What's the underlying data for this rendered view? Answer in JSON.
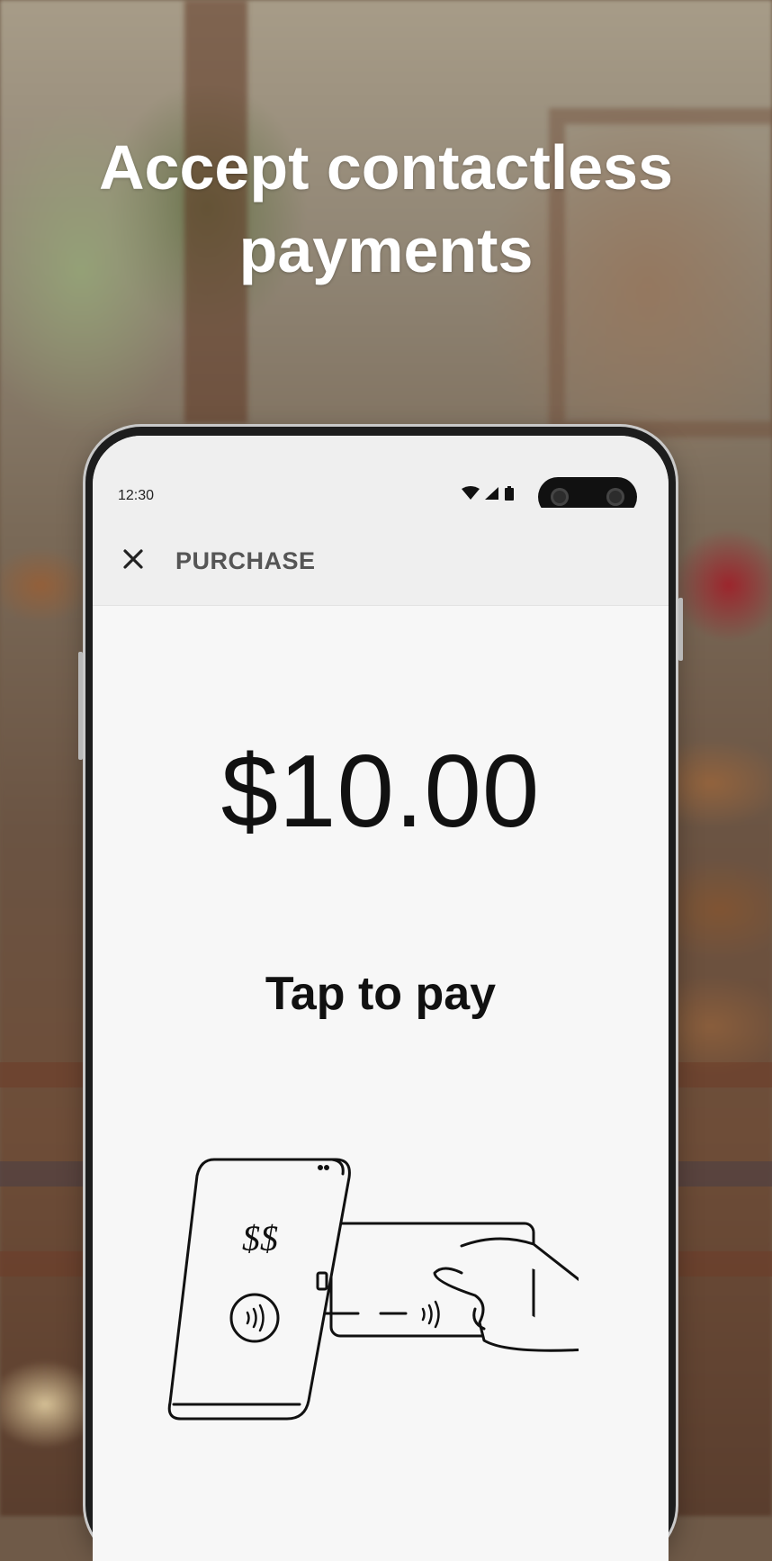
{
  "promo": {
    "headline_line1": "Accept contactless",
    "headline_line2": "payments"
  },
  "status_bar": {
    "time": "12:30",
    "icons": [
      "wifi-icon",
      "signal-icon",
      "battery-icon"
    ]
  },
  "top_bar": {
    "close_icon": "close-icon",
    "title": "PURCHASE"
  },
  "payment": {
    "amount": "$10.00",
    "instruction": "Tap to pay",
    "illustration_symbol": "$$"
  },
  "colors": {
    "headline": "#ffffff",
    "screen_bg": "#f7f7f7",
    "bar_bg": "#efefef",
    "title_text": "#555555",
    "body_text": "#111111"
  }
}
